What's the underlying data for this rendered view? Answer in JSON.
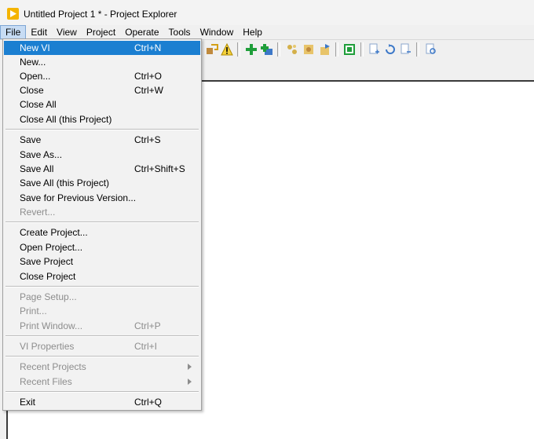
{
  "window": {
    "title": "Untitled Project 1 * - Project Explorer",
    "icon": "labview-run-icon"
  },
  "menubar": {
    "items": [
      "File",
      "Edit",
      "View",
      "Project",
      "Operate",
      "Tools",
      "Window",
      "Help"
    ],
    "active": "File"
  },
  "file_menu": {
    "items": [
      {
        "label": "New VI",
        "shortcut": "Ctrl+N",
        "highlighted": true
      },
      {
        "label": "New...",
        "shortcut": ""
      },
      {
        "label": "Open...",
        "shortcut": "Ctrl+O"
      },
      {
        "label": "Close",
        "shortcut": "Ctrl+W"
      },
      {
        "label": "Close All",
        "shortcut": ""
      },
      {
        "label": "Close All (this Project)",
        "shortcut": ""
      },
      {
        "label": "Save",
        "shortcut": "Ctrl+S"
      },
      {
        "label": "Save As...",
        "shortcut": ""
      },
      {
        "label": "Save All",
        "shortcut": "Ctrl+Shift+S"
      },
      {
        "label": "Save All (this Project)",
        "shortcut": ""
      },
      {
        "label": "Save for Previous Version...",
        "shortcut": ""
      },
      {
        "label": "Revert...",
        "shortcut": "",
        "disabled": true
      },
      {
        "label": "Create Project...",
        "shortcut": ""
      },
      {
        "label": "Open Project...",
        "shortcut": ""
      },
      {
        "label": "Save Project",
        "shortcut": ""
      },
      {
        "label": "Close Project",
        "shortcut": ""
      },
      {
        "label": "Page Setup...",
        "shortcut": "",
        "disabled": true
      },
      {
        "label": "Print...",
        "shortcut": "",
        "disabled": true
      },
      {
        "label": "Print Window...",
        "shortcut": "Ctrl+P",
        "disabled": true
      },
      {
        "label": "VI Properties",
        "shortcut": "Ctrl+I",
        "disabled": true
      },
      {
        "label": "Recent Projects",
        "shortcut": "",
        "disabled": true,
        "submenu": true
      },
      {
        "label": "Recent Files",
        "shortcut": "",
        "disabled": true,
        "submenu": true
      },
      {
        "label": "Exit",
        "shortcut": "Ctrl+Q"
      }
    ]
  },
  "colors": {
    "highlight": "#1b7fd1",
    "disabled_text": "#8d8d8d",
    "app_icon": "#f4b400"
  }
}
